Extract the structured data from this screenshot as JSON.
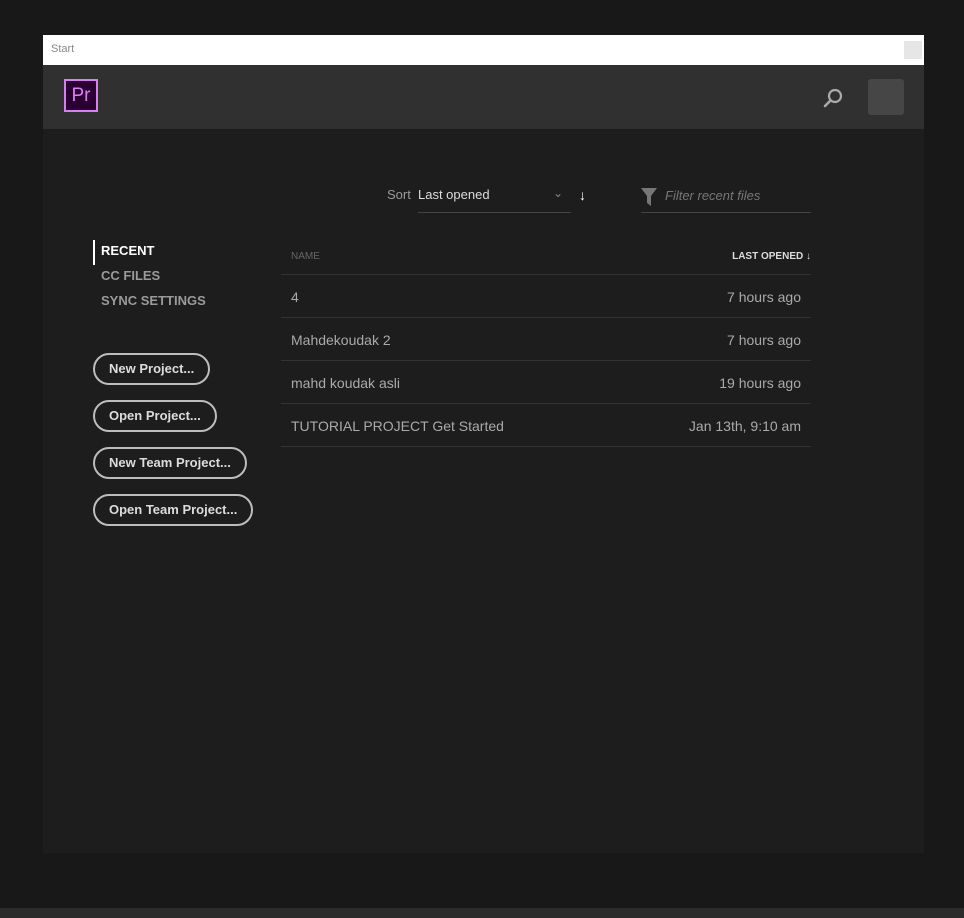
{
  "window": {
    "title": "Start"
  },
  "header": {
    "logo": "Pr",
    "search_icon": "search-icon",
    "accent": "#d67ff0"
  },
  "toolbar": {
    "sort_label": "Sort",
    "sort_value": "Last opened",
    "sort_direction": "↓",
    "filter_placeholder": "Filter recent files"
  },
  "nav": {
    "items": [
      {
        "label": "RECENT",
        "active": true
      },
      {
        "label": "CC FILES"
      },
      {
        "label": "SYNC SETTINGS"
      }
    ]
  },
  "buttons": {
    "new_project": "New Project...",
    "open_project": "Open Project...",
    "new_team_project": "New Team Project...",
    "open_team_project": "Open Team Project..."
  },
  "table": {
    "headers": {
      "name": "NAME",
      "last_opened": "LAST OPENED ↓"
    },
    "rows": [
      {
        "name": "4",
        "date": "7 hours ago"
      },
      {
        "name": "Mahdekoudak 2",
        "date": "7 hours ago"
      },
      {
        "name": "mahd koudak asli",
        "date": "19 hours ago"
      },
      {
        "name": "TUTORIAL PROJECT Get Started",
        "date": "Jan 13th, 9:10 am"
      }
    ]
  }
}
